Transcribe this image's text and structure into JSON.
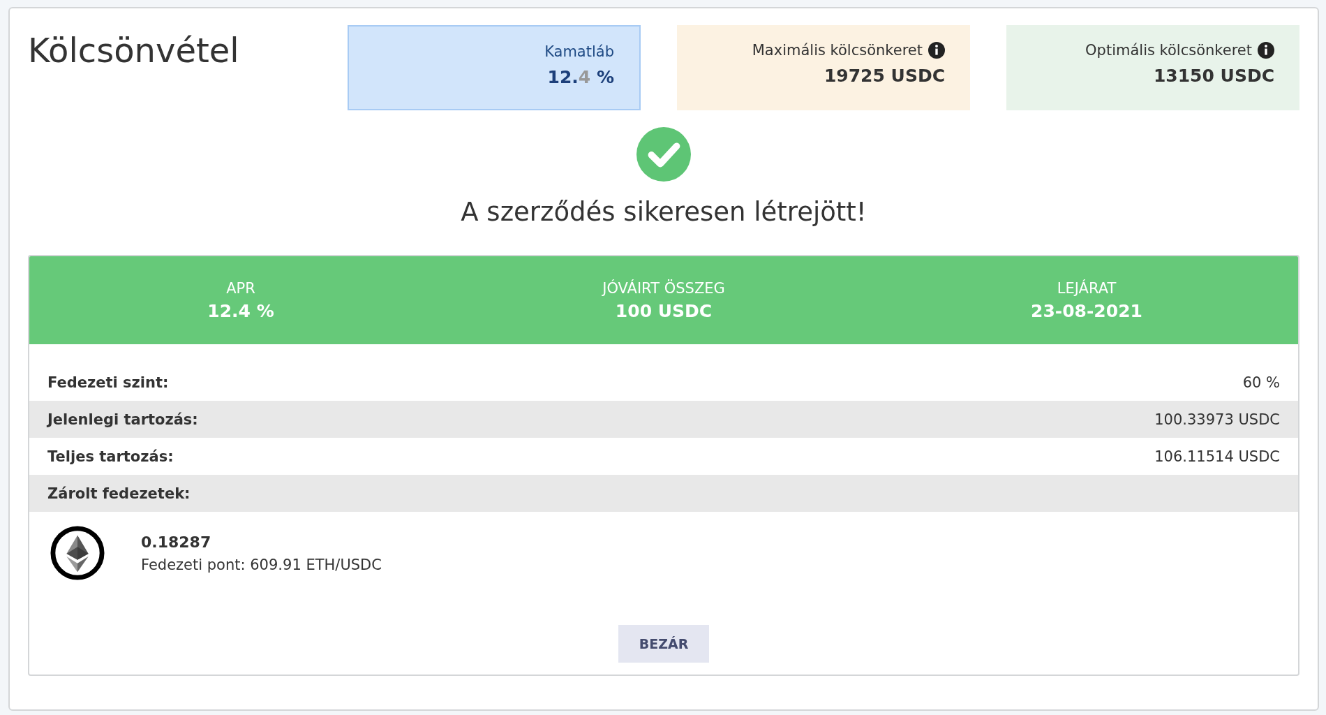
{
  "title": "Kölcsönvétel",
  "stats": [
    {
      "kind": "rate",
      "label": "Kamatláb",
      "value": "12.",
      "value_faded": "4",
      "unit": " %",
      "info": false
    },
    {
      "kind": "max",
      "label": "Maximális kölcsönkeret",
      "value": "19725 USDC",
      "info": true
    },
    {
      "kind": "optimal",
      "label": "Optimális kölcsönkeret",
      "value": "13150 USDC",
      "info": true
    }
  ],
  "message": "A szerződés sikeresen létrejött!",
  "summary": [
    {
      "label": "APR",
      "value": "12.4 %"
    },
    {
      "label": "JÓVÁIRT ÖSSZEG",
      "value": "100 USDC"
    },
    {
      "label": "LEJÁRAT",
      "value": "23-08-2021"
    }
  ],
  "details": [
    {
      "label": "Fedezeti szint:",
      "value": "60 %"
    },
    {
      "label": "Jelenlegi tartozás:",
      "value": "100.33973 USDC"
    },
    {
      "label": "Teljes tartozás:",
      "value": "106.11514 USDC"
    },
    {
      "label": "Zárolt fedezetek:"
    }
  ],
  "collateral": [
    {
      "amount": "0.18287",
      "price": "Fedezeti pont: 609.91 ETH/USDC"
    }
  ],
  "close_button": "BEZÁR"
}
